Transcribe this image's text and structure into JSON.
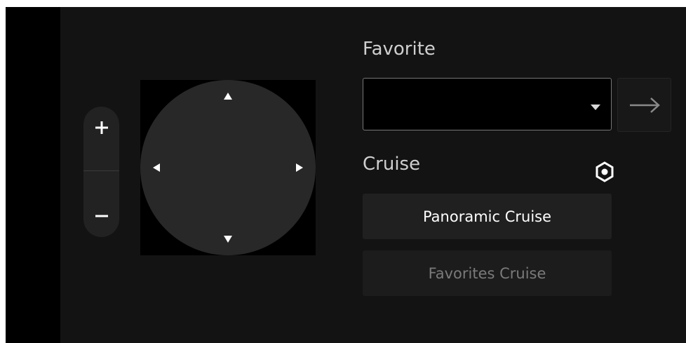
{
  "zoom": {
    "in_label": "+",
    "out_label": "–"
  },
  "ptz": {
    "directions": [
      "up",
      "down",
      "left",
      "right"
    ]
  },
  "favorite": {
    "title": "Favorite",
    "selected_value": "",
    "go_icon": "arrow-right-icon"
  },
  "cruise": {
    "title": "Cruise",
    "settings_icon": "settings-icon",
    "panoramic_label": "Panoramic Cruise",
    "favorites_label": "Favorites Cruise",
    "favorites_disabled": true
  },
  "colors": {
    "background": "#131313",
    "control": "#282828",
    "text_primary": "#ffffff",
    "text_disabled": "#7a7a7a"
  }
}
